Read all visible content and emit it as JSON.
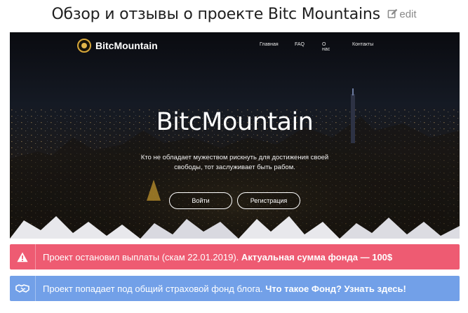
{
  "page": {
    "title": "Обзор и отзывы о проекте Bitc Mountains",
    "edit_label": "edit"
  },
  "screenshot": {
    "logo_text": "BitcMountain",
    "nav": [
      "Главная",
      "FAQ",
      "О нас",
      "Контакты"
    ],
    "hero_title": "BitcMountain",
    "hero_subtitle_line1": "Кто не обладает мужеством рискнуть для достижения своей",
    "hero_subtitle_line2": "свободы, тот заслуживает быть рабом.",
    "login_label": "Войти",
    "register_label": "Регистрация"
  },
  "notices": {
    "stopped_text": "Проект остановил выплаты (скам 22.01.2019).",
    "stopped_bold": "Актуальная сумма фонда — 100$",
    "insurance_text": "Проект попадает под общий страховой фонд блога.",
    "insurance_link": "Что такое Фонд? Узнать здесь!"
  },
  "colors": {
    "notice_red": "#ee5b72",
    "notice_blue": "#72a0e8",
    "logo_gold": "#d7a739"
  },
  "icons": {
    "edit": "edit-icon",
    "warning": "warning-icon",
    "handshake": "handshake-icon"
  }
}
